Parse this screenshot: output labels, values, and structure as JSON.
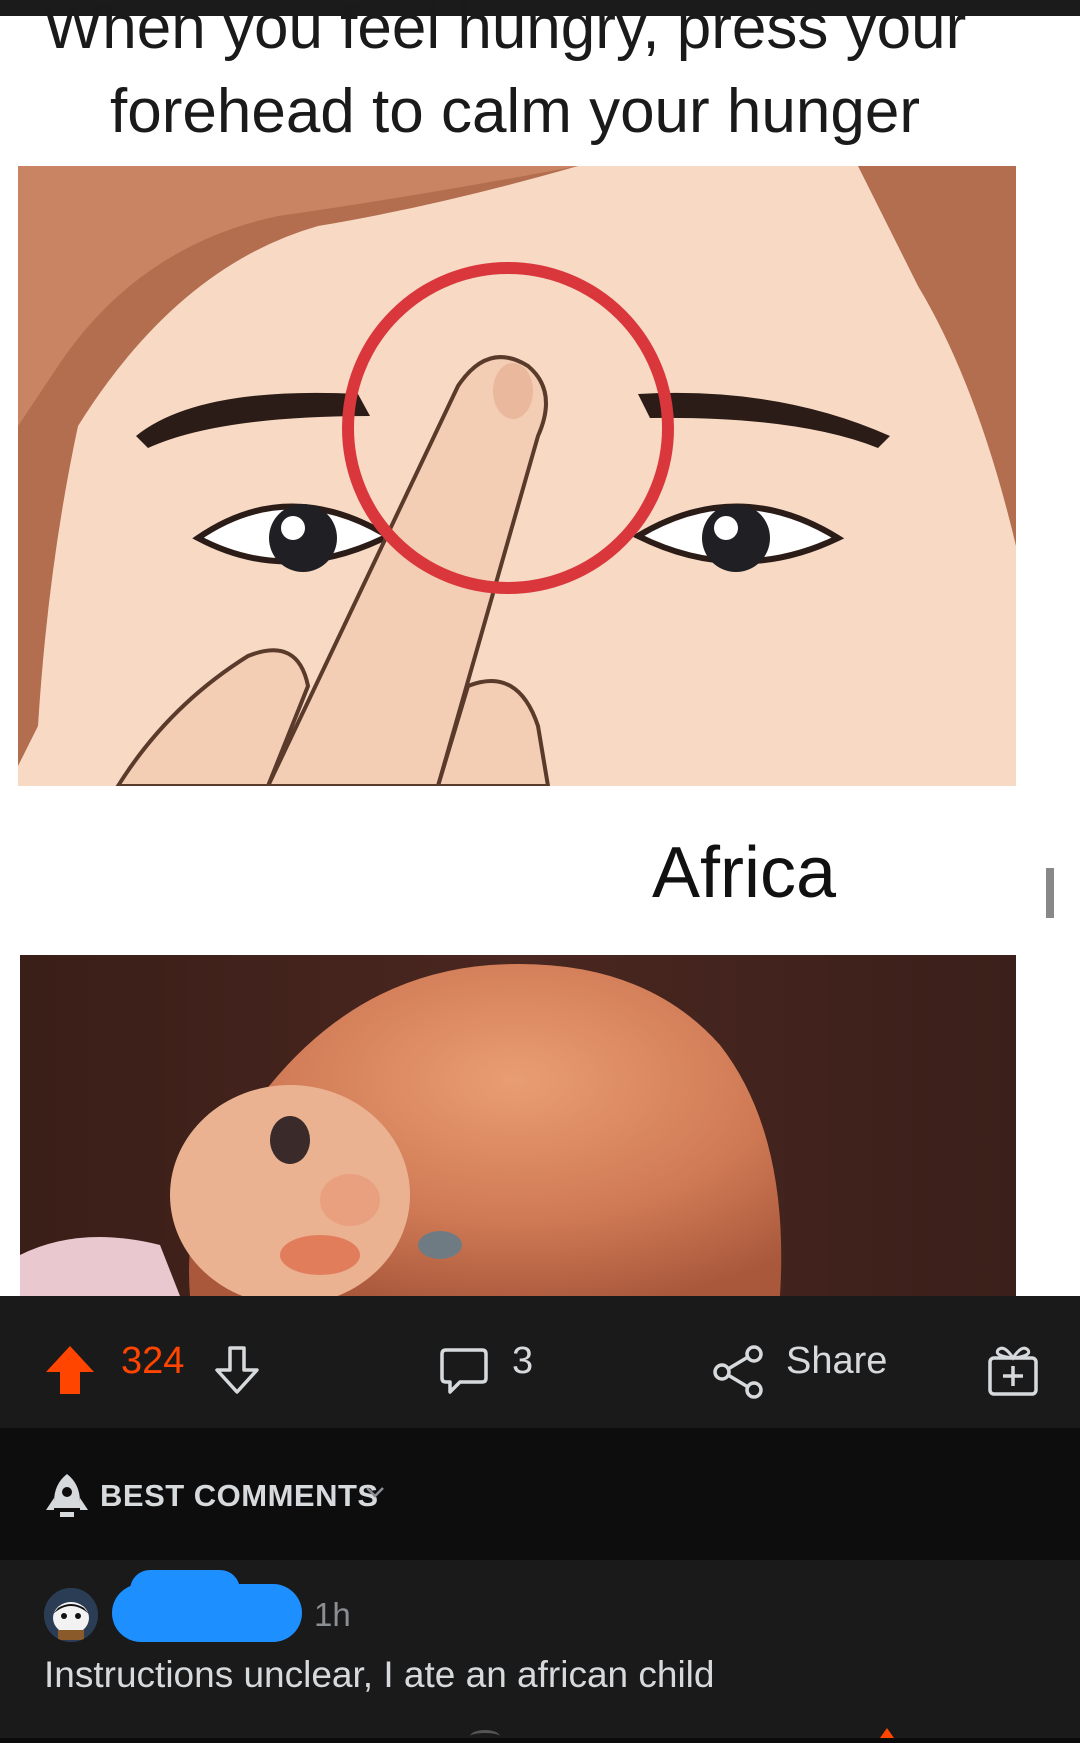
{
  "meme": {
    "caption_line1": "When you feel hungry, press your",
    "caption_line2": "forehead to calm your hunger",
    "panel_label": "Africa"
  },
  "action_bar": {
    "vote_count": "324",
    "comment_count": "3",
    "share_label": "Share",
    "icons": [
      "upvote-icon",
      "downvote-icon",
      "comment-icon",
      "share-icon",
      "award-icon"
    ],
    "colors": {
      "upvoted": "#ff4500",
      "text": "#d7dadc",
      "bar_bg": "#1a1a1b"
    }
  },
  "sort": {
    "label": "BEST COMMENTS",
    "icon": "rocket-icon"
  },
  "comment": {
    "time": "1h",
    "body": "Instructions unclear, I ate an african child",
    "username_redacted_color": "#1d8fff"
  }
}
